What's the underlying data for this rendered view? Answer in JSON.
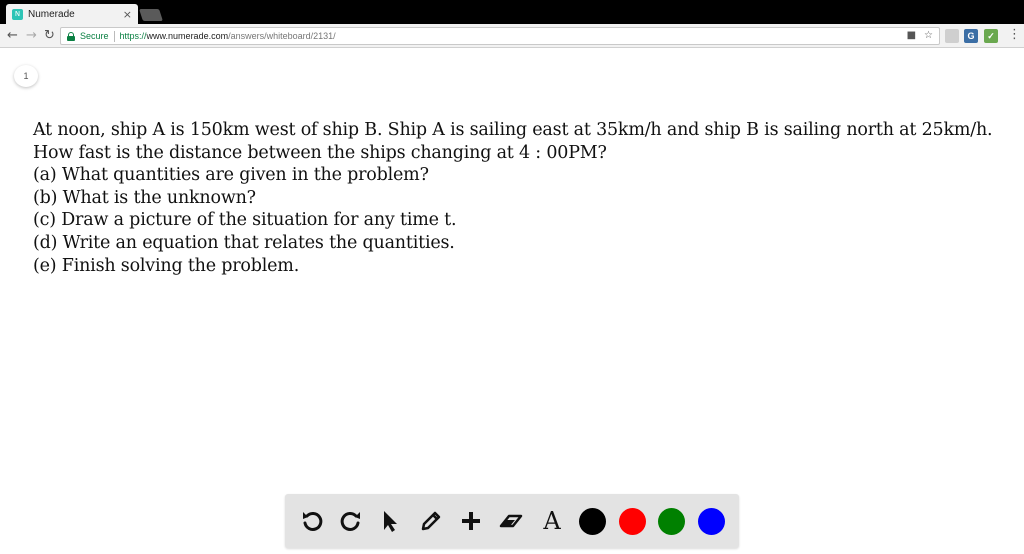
{
  "browser": {
    "tab_title": "Numerade",
    "favicon_letter": "N",
    "tab_close": "×",
    "secure_label": "Secure",
    "url_scheme": "https://",
    "url_host": "www.numerade.com",
    "url_path": "/answers/whiteboard/2131/"
  },
  "page": {
    "page_number": "1",
    "problem_lines": [
      "At noon, ship A is 150km west of ship B. Ship A is sailing east at 35km/h and ship B is sailing north at 25km/h.",
      "How fast is the distance between the ships changing at 4 : 00PM?",
      "(a) What quantities are given in the problem?",
      "(b) What is the unknown?",
      "(c) Draw a picture of the situation for any time t.",
      "(d) Write an equation that relates the quantities.",
      "(e) Finish solving the problem."
    ]
  },
  "whiteboard_toolbar": {
    "tools": [
      "undo-icon",
      "redo-icon",
      "pointer-icon",
      "pen-icon",
      "plus-icon",
      "eraser-icon",
      "text-icon"
    ],
    "text_tool_label": "A",
    "colors": [
      "#000000",
      "#ff0000",
      "#008000",
      "#0000ff"
    ]
  }
}
